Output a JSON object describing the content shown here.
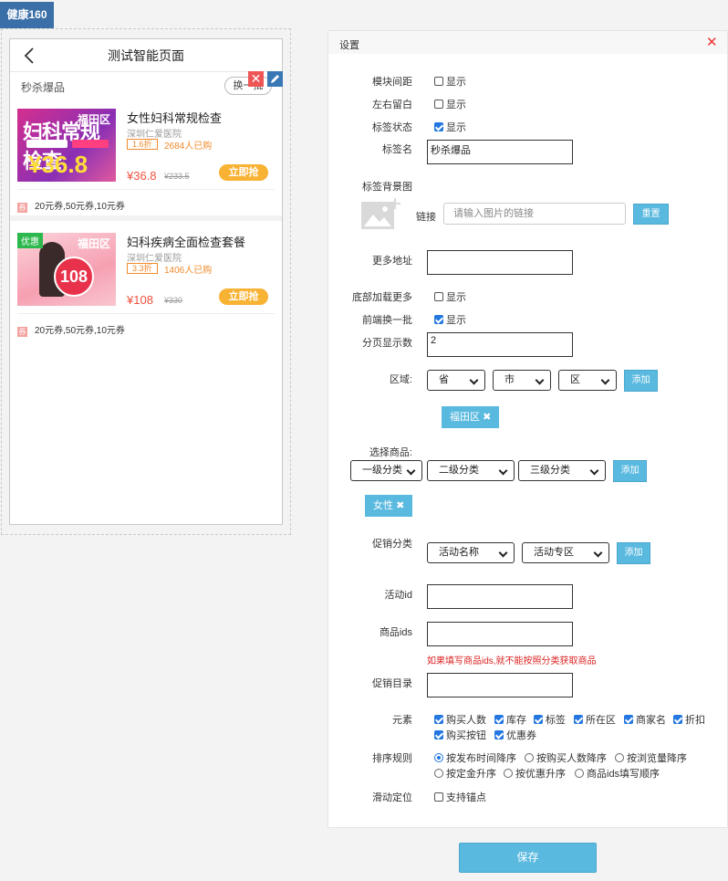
{
  "brand": "健康160",
  "preview": {
    "title": "测试智能页面",
    "section_title": "秒杀爆品",
    "swap_label": "换一批",
    "products": [
      {
        "image_location": "福田区",
        "image_headline": "妇科常规检查",
        "image_price": "¥36.8",
        "name": "女性妇科常规检查",
        "shop": "深圳仁爱医院",
        "discount": "1.6折",
        "sold": "2684人已购",
        "price": "¥36.8",
        "orig_price": "¥233.5",
        "buy_label": "立即抢",
        "coupons": "20元券,50元券,10元券",
        "coupon_icon": "券"
      },
      {
        "image_badge": "优惠",
        "image_location": "福田区",
        "image_price": "108",
        "name": "妇科疾病全面检查套餐",
        "shop": "深圳仁爱医院",
        "discount": "3.3折",
        "sold": "1406人已购",
        "price": "¥108",
        "orig_price": "¥330",
        "buy_label": "立即抢",
        "coupons": "20元券,50元券,10元券",
        "coupon_icon": "券"
      }
    ]
  },
  "settings": {
    "title": "设置",
    "close_icon": "close-icon",
    "module_spacing": {
      "label": "模块间距",
      "option": "显示",
      "checked": false
    },
    "side_margin": {
      "label": "左右留白",
      "option": "显示",
      "checked": false
    },
    "tag_status": {
      "label": "标签状态",
      "option": "显示",
      "checked": true
    },
    "tag_name": {
      "label": "标签名",
      "value": "秒杀爆品"
    },
    "tag_bg": {
      "label": "标签背景图",
      "link_label": "链接",
      "placeholder": "请输入图片的链接",
      "reset_label": "重置"
    },
    "more_url": {
      "label": "更多地址",
      "value": ""
    },
    "bottom_load_more": {
      "label": "底部加载更多",
      "option": "显示",
      "checked": false
    },
    "frontend_swap": {
      "label": "前端换一批",
      "option": "显示",
      "checked": true
    },
    "page_size": {
      "label": "分页显示数",
      "value": "2"
    },
    "region": {
      "label": "区域:",
      "province": "省",
      "city": "市",
      "district": "区",
      "add_label": "添加",
      "chip": "福田区"
    },
    "goods": {
      "label": "选择商品:",
      "cat1": "一级分类",
      "cat2": "二级分类",
      "cat3": "三级分类",
      "add_label": "添加",
      "chip": "女性"
    },
    "promo_category": {
      "label": "促销分类",
      "sel1": "活动名称",
      "sel2": "活动专区",
      "add_label": "添加"
    },
    "activity_id": {
      "label": "活动id",
      "value": ""
    },
    "goods_ids": {
      "label": "商品ids",
      "value": "",
      "warning": "如果填写商品ids,就不能按照分类获取商品"
    },
    "promo_dir": {
      "label": "促销目录",
      "value": ""
    },
    "elements": {
      "label": "元素",
      "items": [
        {
          "text": "购买人数",
          "checked": true
        },
        {
          "text": "库存",
          "checked": true
        },
        {
          "text": "标签",
          "checked": true
        },
        {
          "text": "所在区",
          "checked": true
        },
        {
          "text": "商家名",
          "checked": true
        },
        {
          "text": "折扣",
          "checked": true
        },
        {
          "text": "购买按钮",
          "checked": true
        },
        {
          "text": "优惠券",
          "checked": true
        }
      ]
    },
    "sort": {
      "label": "排序规则",
      "options": [
        "按发布时间降序",
        "按购买人数降序",
        "按浏览量降序",
        "按定金升序",
        "按优惠升序",
        "商品ids填写顺序"
      ],
      "selected": 0
    },
    "scroll_anchor": {
      "label": "滑动定位",
      "option": "支持锚点",
      "checked": false
    }
  },
  "save_label": "保存",
  "colors": {
    "accent": "#5ab9df",
    "brand": "#3a6fa8",
    "price": "#f0513d",
    "warning": "#dd2222"
  }
}
